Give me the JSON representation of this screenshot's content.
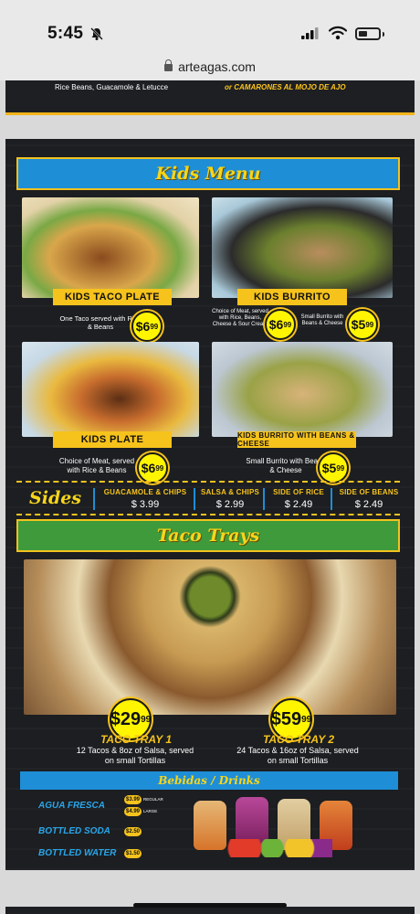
{
  "status_bar": {
    "time": "5:45"
  },
  "browser": {
    "url": "arteagas.com"
  },
  "previous_section": {
    "left_text": "Rice Beans, Guacamole & Letucce",
    "right_text": "or CAMARONES AL MOJO DE AJO"
  },
  "kids_menu": {
    "title": "Kids Menu",
    "items": [
      {
        "name": "KIDS TACO PLATE",
        "description": "One Taco served with Rice & Beans",
        "price_dollars": "6",
        "price_cents": "99"
      },
      {
        "name": "KIDS BURRITO",
        "description": "Choice of Meat, served with Rice, Beans, Cheese & Sour Cream",
        "price_dollars": "6",
        "price_cents": "99",
        "alt_description": "Small Burrito with Beans & Cheese",
        "alt_price_dollars": "5",
        "alt_price_cents": "99"
      },
      {
        "name": "KIDS PLATE",
        "description": "Choice of Meat, served with Rice & Beans",
        "price_dollars": "6",
        "price_cents": "99"
      },
      {
        "name": "KIDS BURRITO WITH BEANS & CHEESE",
        "description": "Small Burrito with Beans & Cheese",
        "price_dollars": "5",
        "price_cents": "99"
      }
    ]
  },
  "sides": {
    "title": "Sides",
    "items": [
      {
        "name": "GUACAMOLE & CHIPS",
        "price": "$ 3.99"
      },
      {
        "name": "SALSA & CHIPS",
        "price": "$ 2.99"
      },
      {
        "name": "SIDE OF RICE",
        "price": "$ 2.49"
      },
      {
        "name": "SIDE OF BEANS",
        "price": "$ 2.49"
      }
    ]
  },
  "taco_trays": {
    "title": "Taco Trays",
    "items": [
      {
        "name": "TACO TRAY 1",
        "description": "12 Tacos & 8oz of Salsa, served on small Tortillas",
        "price_dollars": "29",
        "price_cents": "99"
      },
      {
        "name": "TACO TRAY 2",
        "description": "24 Tacos & 16oz of Salsa, served on small Tortillas",
        "price_dollars": "59",
        "price_cents": "99"
      }
    ]
  },
  "drinks": {
    "title": "Bebidas / Drinks",
    "items": [
      {
        "name": "AGUA FRESCA",
        "price_regular": "$3.99",
        "label_regular": "REGULAR",
        "price_large": "$4.99",
        "label_large": "LARGE"
      },
      {
        "name": "BOTTLED SODA",
        "price": "$2.50"
      },
      {
        "name": "BOTTLED WATER",
        "price": "$1.50"
      }
    ]
  },
  "colors": {
    "panel": "#1c1e21",
    "accent_yellow": "#f6c31c",
    "banner_blue": "#1e8ed6",
    "banner_green": "#3e9a3a"
  }
}
